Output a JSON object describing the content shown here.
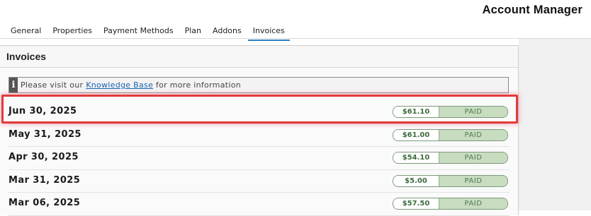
{
  "app": {
    "title": "Account Manager"
  },
  "tabs": [
    {
      "label": "General"
    },
    {
      "label": "Properties"
    },
    {
      "label": "Payment Methods"
    },
    {
      "label": "Plan"
    },
    {
      "label": "Addons"
    },
    {
      "label": "Invoices",
      "active": true
    }
  ],
  "panel": {
    "title": "Invoices",
    "info": {
      "icon": "info-icon",
      "text_before": "Please visit our ",
      "link_text": "Knowledge Base",
      "text_after": " for more information"
    }
  },
  "invoices": [
    {
      "date": "Jun 30, 2025",
      "amount": "$61.10",
      "status": "PAID",
      "highlighted": true
    },
    {
      "date": "May 31, 2025",
      "amount": "$61.00",
      "status": "PAID"
    },
    {
      "date": "Apr 30, 2025",
      "amount": "$54.10",
      "status": "PAID"
    },
    {
      "date": "Mar 31, 2025",
      "amount": "$5.00",
      "status": "PAID"
    },
    {
      "date": "Mar 06, 2025",
      "amount": "$57.50",
      "status": "PAID"
    }
  ],
  "colors": {
    "accent_tab_underline": "#2f7fbf",
    "link": "#1a63b5",
    "paid_bg": "#c8dcbf",
    "paid_border": "#7a9a7a",
    "highlight_border": "#e23a3a"
  }
}
